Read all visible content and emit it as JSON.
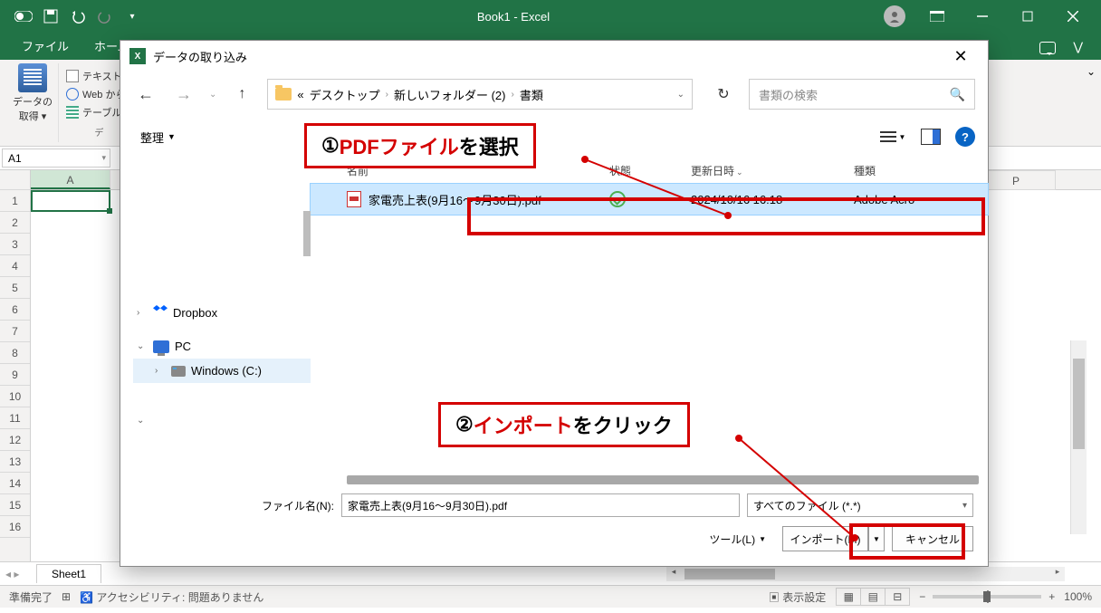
{
  "excel": {
    "title": "Book1 - Excel",
    "tabs": {
      "file": "ファイル",
      "home": "ホーム"
    },
    "ribbon": {
      "datagetter_l1": "データの",
      "datagetter_l2": "取得",
      "text_csv": "テキストま",
      "web": "Web から",
      "table": "テーブルま",
      "group": "デ"
    },
    "name_box": "A1",
    "col_a": "A",
    "col_p": "P",
    "rows": [
      "1",
      "2",
      "3",
      "4",
      "5",
      "6",
      "7",
      "8",
      "9",
      "10",
      "11",
      "12",
      "13",
      "14",
      "15",
      "16"
    ],
    "sheet": "Sheet1",
    "status": {
      "ready": "準備完了",
      "accessibility": "アクセシビリティ: 問題ありません",
      "display": "表示設定",
      "zoom": "100%"
    }
  },
  "dialog": {
    "title": "データの取り込み",
    "breadcrumb": {
      "pre": "«",
      "b1": "デスクトップ",
      "b2": "新しいフォルダー (2)",
      "b3": "書類"
    },
    "search": {
      "placeholder": "書類の検索"
    },
    "toolbar": {
      "organize": "整理"
    },
    "columns": {
      "name": "名前",
      "status": "状態",
      "date": "更新日時",
      "type": "種類"
    },
    "file": {
      "name": "家電売上表(9月16～9月30日).pdf",
      "date": "2024/10/16 16:18",
      "type": "Adobe Acro"
    },
    "tree": {
      "dropbox": "Dropbox",
      "pc": "PC",
      "drive": "Windows (C:)"
    },
    "footer": {
      "filename_label": "ファイル名(N):",
      "filename_value": "家電売上表(9月16～9月30日).pdf",
      "filetype": "すべてのファイル (*.*)",
      "tools": "ツール(L)",
      "import": "インポート(M)",
      "cancel": "キャンセル"
    }
  },
  "annotations": {
    "a1_num": "①",
    "a1_red": "PDFファイル",
    "a1_black": "を選択",
    "a2_num": "②",
    "a2_red": "インポート",
    "a2_black": "をクリック"
  }
}
